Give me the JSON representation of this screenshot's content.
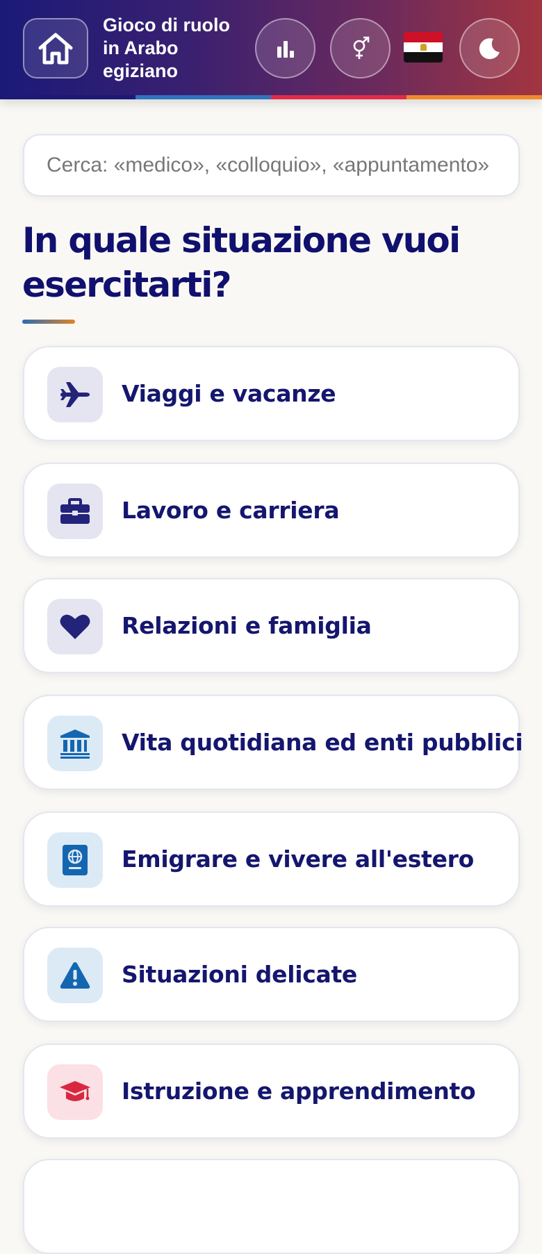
{
  "header": {
    "home_icon": "home-icon",
    "title_lines": [
      "Gioco di ruolo",
      "in Arabo",
      "egiziano"
    ],
    "stats_icon": "bar-chart-icon",
    "gender_icon": "gender-symbol-icon",
    "flag_icon": "egypt-flag-icon",
    "theme_icon": "moon-icon",
    "stripe_colors": [
      "#1b1a78",
      "#2f74c0",
      "#e02c4a",
      "#f08a2c"
    ]
  },
  "search": {
    "placeholder": "Cerca: «medico», «colloquio», «appuntamento»",
    "value": ""
  },
  "main": {
    "heading": "In quale situazione vuoi esercitarti?",
    "categories": [
      {
        "label": "Viaggi e vacanze",
        "icon": "airplane-icon",
        "icon_bg": "#e5e5f2",
        "icon_color": "#24237a"
      },
      {
        "label": "Lavoro e carriera",
        "icon": "briefcase-icon",
        "icon_bg": "#e5e5f2",
        "icon_color": "#24237a"
      },
      {
        "label": "Relazioni e famiglia",
        "icon": "heart-icon",
        "icon_bg": "#e5e5f2",
        "icon_color": "#24237a"
      },
      {
        "label": "Vita quotidiana ed enti pubblici",
        "icon": "bank-building-icon",
        "icon_bg": "#dceaf6",
        "icon_color": "#1566b0"
      },
      {
        "label": "Emigrare e vivere all'estero",
        "icon": "passport-icon",
        "icon_bg": "#dceaf6",
        "icon_color": "#1566b0"
      },
      {
        "label": "Situazioni delicate",
        "icon": "warning-icon",
        "icon_bg": "#dceaf6",
        "icon_color": "#1566b0"
      },
      {
        "label": "Istruzione e apprendimento",
        "icon": "graduation-cap-icon",
        "icon_bg": "#fbe0e5",
        "icon_color": "#d8283f"
      },
      {
        "label": "",
        "icon": "",
        "icon_bg": "#ffffff",
        "icon_color": "#ffffff"
      }
    ]
  },
  "colors": {
    "heading": "#10106e",
    "page_bg": "#f9f8f4",
    "card_bg": "#ffffff"
  }
}
